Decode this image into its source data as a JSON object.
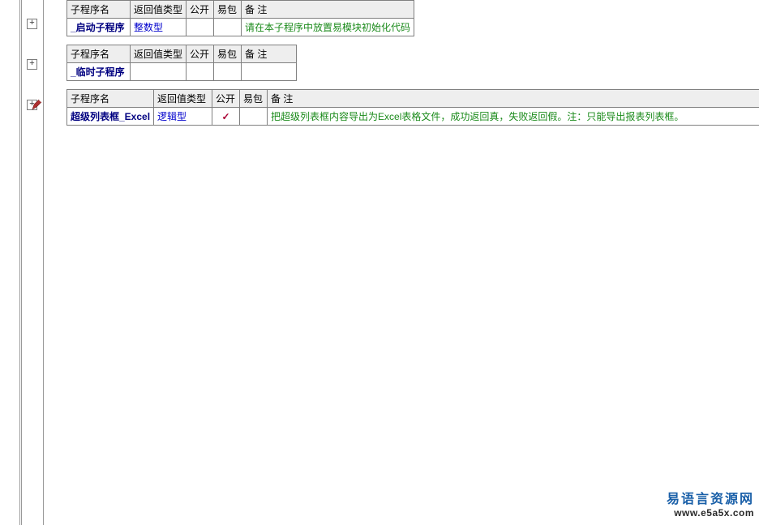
{
  "headers": {
    "name": "子程序名",
    "retType": "返回值类型",
    "public": "公开",
    "pkg": "易包",
    "note": "备 注"
  },
  "blocks": [
    {
      "name": "_启动子程序",
      "type": "整数型",
      "public": "",
      "pkg": "",
      "note": "请在本子程序中放置易模块初始化代码"
    },
    {
      "name": "_临时子程序",
      "type": "",
      "public": "",
      "pkg": "",
      "note": ""
    },
    {
      "name": "超级列表框_Excel",
      "type": "逻辑型",
      "public": "✓",
      "pkg": "",
      "note": "把超级列表框内容导出为Excel表格文件，成功返回真，失败返回假。注：只能导出报表列表框。"
    }
  ],
  "expand": "+",
  "watermark": {
    "cn": "易语言资源网",
    "url": "www.e5a5x.com"
  }
}
